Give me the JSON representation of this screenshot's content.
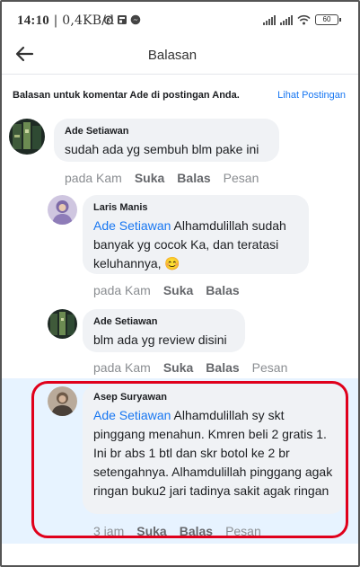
{
  "status_bar": {
    "time": "14:10",
    "speed": " | 0,4KB/d",
    "battery": "60"
  },
  "header": {
    "title": "Balasan"
  },
  "notice": {
    "text": "Balasan untuk komentar Ade di postingan Anda.",
    "link": "Lihat Postingan"
  },
  "comments": [
    {
      "author": "Ade Setiawan",
      "mention": "",
      "text": "sudah ada yg sembuh blm pake ini",
      "time": "pada Kam",
      "like": "Suka",
      "reply": "Balas",
      "message": "Pesan"
    },
    {
      "author": "Laris Manis",
      "mention": "Ade Setiawan",
      "text": " Alhamdulillah sudah banyak yg cocok Ka, dan teratasi keluhannya, 😊",
      "time": "pada Kam",
      "like": "Suka",
      "reply": "Balas"
    },
    {
      "author": "Ade Setiawan",
      "mention": "",
      "text": "blm ada yg review disini",
      "time": "pada Kam",
      "like": "Suka",
      "reply": "Balas",
      "message": "Pesan"
    },
    {
      "author": "Asep Suryawan",
      "mention": "Ade Setiawan",
      "text": " Alhamdulillah sy skt pinggang menahun. Kmren beli 2 gratis 1. Ini br abs 1 btl dan skr botol ke 2 br setengahnya. Alhamdulillah pinggang agak ringan buku2 jari tadinya sakit agak ringan",
      "time": "3 jam",
      "like": "Suka",
      "reply": "Balas",
      "message": "Pesan"
    }
  ],
  "colors": {
    "link": "#1877f2",
    "highlight": "#e7f3ff",
    "annotation": "#e0001b"
  }
}
